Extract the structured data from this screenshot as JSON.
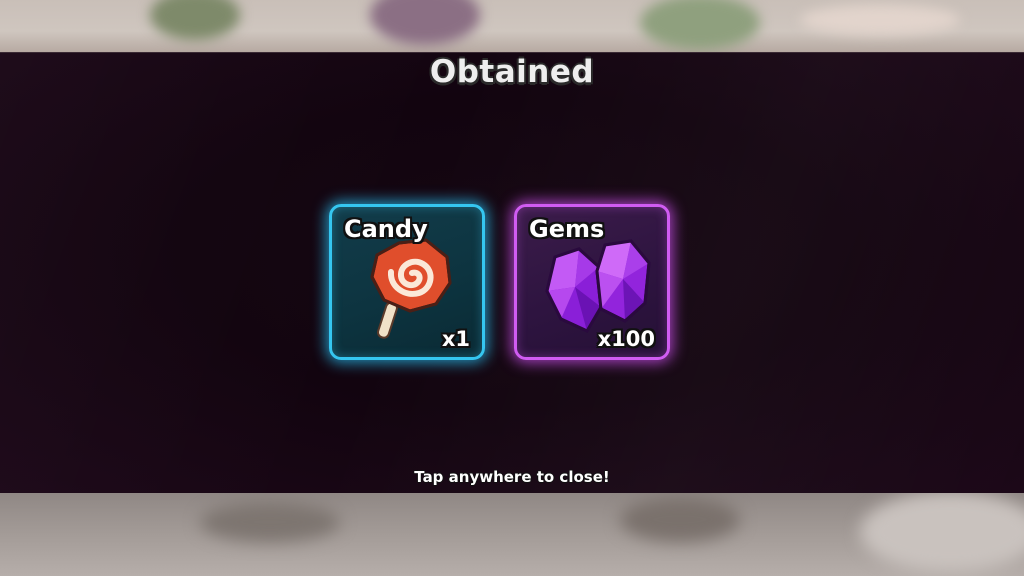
{
  "popup": {
    "title": "Obtained",
    "close_hint": "Tap anywhere to close!"
  },
  "rewards": [
    {
      "name": "Candy",
      "quantity": "x1",
      "icon": "lollipop-icon",
      "glow_color": "#35c6f0"
    },
    {
      "name": "Gems",
      "quantity": "x100",
      "icon": "gems-icon",
      "glow_color": "#d05cf2"
    }
  ]
}
